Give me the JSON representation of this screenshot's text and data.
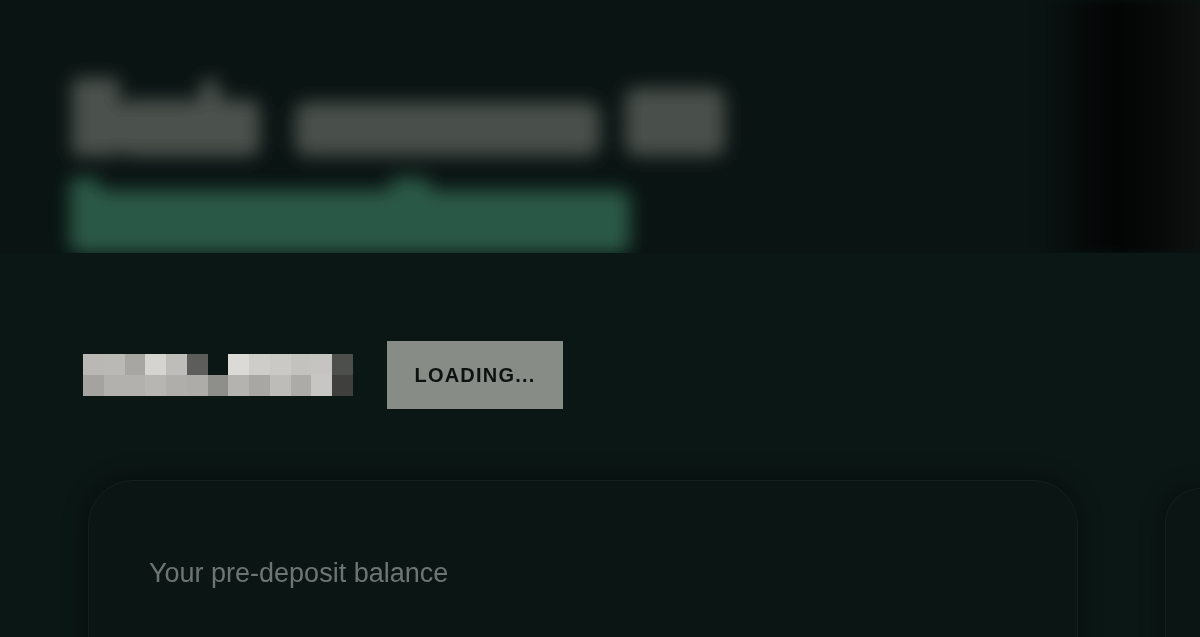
{
  "account_row": {
    "button": {
      "label": "LOADING..."
    }
  },
  "balance_card": {
    "label": "Your pre-deposit balance"
  }
}
